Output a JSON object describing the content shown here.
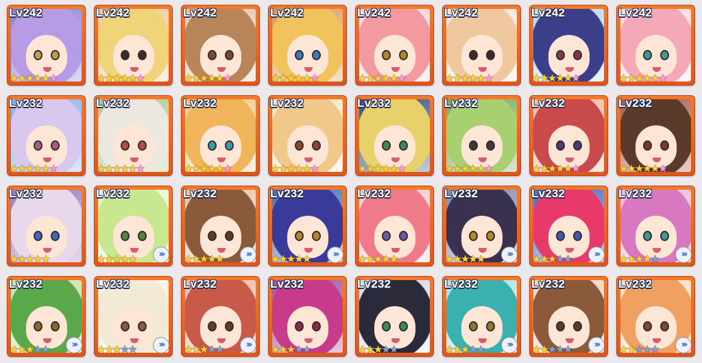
{
  "cards": [
    {
      "level": "Lv242",
      "stars": 5,
      "pink": true,
      "rank_up": false,
      "hair": "#b69be6",
      "bg": "#8a7fd0",
      "eye": "#b9a04a"
    },
    {
      "level": "Lv242",
      "stars": 5,
      "pink": true,
      "rank_up": false,
      "hair": "#f0d47a",
      "bg": "#f2c8a0",
      "eye": "#3a2a2a"
    },
    {
      "level": "Lv242",
      "stars": 5,
      "pink": true,
      "rank_up": false,
      "hair": "#b8855a",
      "bg": "#e8c4a8",
      "eye": "#7a4a2a"
    },
    {
      "level": "Lv242",
      "stars": 5,
      "pink": true,
      "rank_up": false,
      "hair": "#f2c25c",
      "bg": "#d99a5a",
      "eye": "#3d7ab8"
    },
    {
      "level": "Lv242",
      "stars": 5,
      "pink": true,
      "rank_up": false,
      "hair": "#f29aa0",
      "bg": "#f6d2d8",
      "eye": "#b08a2a"
    },
    {
      "level": "Lv242",
      "stars": 5,
      "pink": true,
      "rank_up": false,
      "hair": "#f0c8a0",
      "bg": "#f4e2dc",
      "eye": "#3a2a2a"
    },
    {
      "level": "Lv242",
      "stars": 5,
      "pink": true,
      "rank_up": false,
      "hair": "#3b3f8a",
      "bg": "#b8d6ec",
      "eye": "#7a3a4a"
    },
    {
      "level": "Lv242",
      "stars": 5,
      "pink": true,
      "rank_up": false,
      "hair": "#f4a8b8",
      "bg": "#f6dae0",
      "eye": "#3a9a9a"
    },
    {
      "level": "Lv232",
      "stars": 5,
      "pink": true,
      "rank_up": false,
      "hair": "#d8c8f0",
      "bg": "#8ab0e8",
      "eye": "#b05a8a"
    },
    {
      "level": "Lv232",
      "stars": 5,
      "pink": true,
      "rank_up": false,
      "hair": "#ece8e0",
      "bg": "#a8c890",
      "eye": "#b84a4a"
    },
    {
      "level": "Lv232",
      "stars": 5,
      "pink": true,
      "rank_up": false,
      "hair": "#f0b45a",
      "bg": "#f2c880",
      "eye": "#3a9ab0"
    },
    {
      "level": "Lv232",
      "stars": 5,
      "pink": true,
      "rank_up": false,
      "hair": "#f0c88a",
      "bg": "#f4e4c8",
      "eye": "#8a4a2a"
    },
    {
      "level": "Lv232",
      "stars": 5,
      "pink": true,
      "rank_up": false,
      "hair": "#e8d06a",
      "bg": "#3a4a7a",
      "eye": "#3a8a5a"
    },
    {
      "level": "Lv232",
      "stars": 5,
      "pink": true,
      "rank_up": false,
      "hair": "#a8d070",
      "bg": "#7aa860",
      "eye": "#3a3a3a"
    },
    {
      "level": "Lv232",
      "stars": 5,
      "pink": true,
      "rank_up": false,
      "hair": "#c84a4a",
      "bg": "#f2b8a0",
      "eye": "#4a3a7a"
    },
    {
      "level": "Lv232",
      "stars": 5,
      "pink": true,
      "rank_up": false,
      "hair": "#5a3a2a",
      "bg": "#a8584a",
      "eye": "#7a3a2a"
    },
    {
      "level": "Lv232",
      "stars": 5,
      "pink": false,
      "rank_up": false,
      "hair": "#e8d8ec",
      "bg": "#9a7ac0",
      "eye": "#3a6ac0"
    },
    {
      "level": "Lv232",
      "stars": 5,
      "pink": false,
      "rank_up": true,
      "hair": "#c8e890",
      "bg": "#e8f4d0",
      "eye": "#4a8a3a"
    },
    {
      "level": "Lv232",
      "stars": 5,
      "pink": false,
      "rank_up": true,
      "hair": "#8a5a3a",
      "bg": "#e8c4a0",
      "eye": "#5a3a2a"
    },
    {
      "level": "Lv232",
      "stars": 5,
      "pink": false,
      "rank_up": true,
      "hair": "#3a3a9a",
      "bg": "#4a6ab0",
      "eye": "#b08a2a"
    },
    {
      "level": "Lv232",
      "stars": 5,
      "pink": false,
      "rank_up": false,
      "hair": "#f07a8a",
      "bg": "#f4c8cc",
      "eye": "#6a5aa8"
    },
    {
      "level": "Lv232",
      "stars": 5,
      "pink": false,
      "rank_up": true,
      "hair": "#3a3050",
      "bg": "#7a8ab8",
      "eye": "#b08a2a"
    },
    {
      "level": "Lv232",
      "stars": 3,
      "pink": false,
      "rank_up": true,
      "hair": "#e83a6a",
      "bg": "#4a6ab8",
      "eye": "#3a5ab8"
    },
    {
      "level": "Lv232",
      "stars": 4,
      "pink": false,
      "rank_up": true,
      "hair": "#d878c0",
      "bg": "#e8b8d8",
      "eye": "#3a9a9a"
    },
    {
      "level": "Lv232",
      "stars": 3,
      "pink": false,
      "rank_up": true,
      "hair": "#5aa84a",
      "bg": "#c8e0a8",
      "eye": "#8a6a2a"
    },
    {
      "level": "Lv232",
      "stars": 3,
      "pink": false,
      "rank_up": true,
      "hair": "#f2ead4",
      "bg": "#f8f0e4",
      "eye": "#8a5a3a"
    },
    {
      "level": "Lv232",
      "stars": 3,
      "pink": false,
      "rank_up": true,
      "hair": "#c85a4a",
      "bg": "#f0b8a0",
      "eye": "#6a3a2a"
    },
    {
      "level": "Lv232",
      "stars": 3,
      "pink": false,
      "rank_up": false,
      "hair": "#c83a8a",
      "bg": "#a04aa0",
      "eye": "#8a2a4a"
    },
    {
      "level": "Lv232",
      "stars": 3,
      "pink": false,
      "rank_up": false,
      "hair": "#2a2a3a",
      "bg": "#d8d8e8",
      "eye": "#3a8a5a"
    },
    {
      "level": "Lv232",
      "stars": 3,
      "pink": false,
      "rank_up": true,
      "hair": "#3ab0b0",
      "bg": "#a8e0e0",
      "eye": "#8a7a2a"
    },
    {
      "level": "Lv232",
      "stars": 2,
      "pink": false,
      "rank_up": true,
      "hair": "#8a5a3a",
      "bg": "#f0d0b8",
      "eye": "#5a3a2a"
    },
    {
      "level": "Lv232",
      "stars": 2,
      "pink": false,
      "rank_up": true,
      "hair": "#f0a060",
      "bg": "#f8dcc0",
      "eye": "#7a4a2a"
    }
  ]
}
